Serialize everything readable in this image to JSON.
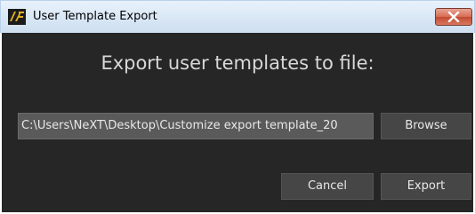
{
  "window": {
    "title": "User Template Export",
    "app_icon": "next-logo-icon",
    "close_icon": "close-icon"
  },
  "dialog": {
    "heading": "Export user templates to file:",
    "path_value": "C:\\Users\\NeXT\\Desktop\\Customize export template_20",
    "browse_label": "Browse",
    "cancel_label": "Cancel",
    "export_label": "Export"
  },
  "colors": {
    "content_background": "#262626",
    "button_background": "#464646",
    "field_background": "#5a5a5a",
    "close_button": "#c14a30"
  }
}
